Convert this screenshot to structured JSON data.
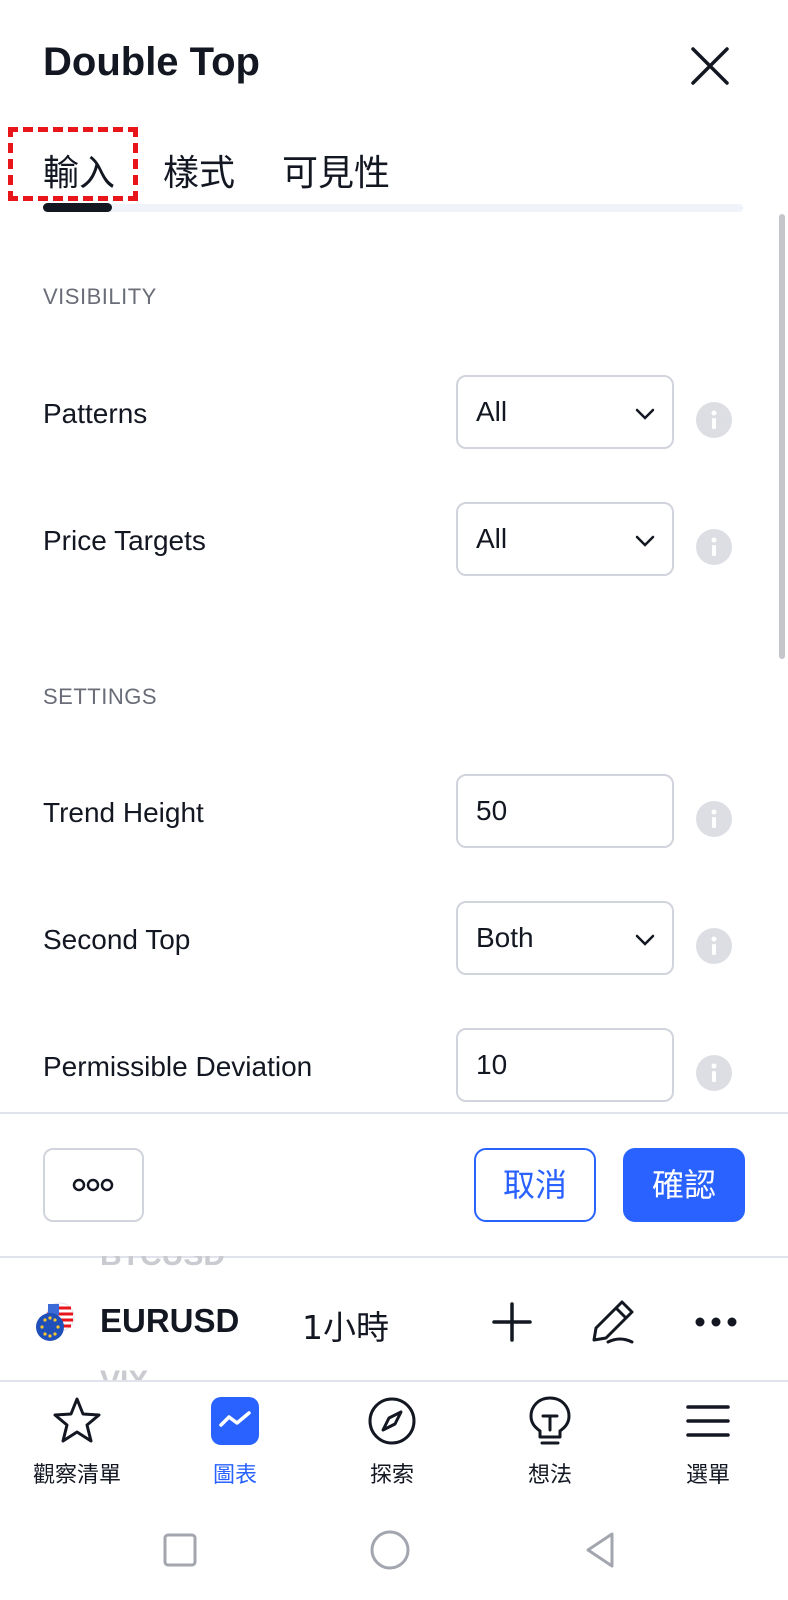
{
  "dialog": {
    "title": "Double Top",
    "tabs": [
      {
        "label": "輸入",
        "active": true
      },
      {
        "label": "樣式",
        "active": false
      },
      {
        "label": "可見性",
        "active": false
      }
    ]
  },
  "sections": {
    "visibility": {
      "header": "VISIBILITY",
      "rows": [
        {
          "label": "Patterns",
          "value": "All"
        },
        {
          "label": "Price Targets",
          "value": "All"
        }
      ]
    },
    "settings": {
      "header": "SETTINGS",
      "rows": [
        {
          "label": "Trend Height",
          "value": "50"
        },
        {
          "label": "Second Top",
          "value": "Both"
        },
        {
          "label": "Permissible Deviation",
          "value": "10"
        }
      ]
    }
  },
  "footer": {
    "more_label": "◦◦◦",
    "cancel_label": "取消",
    "ok_label": "確認"
  },
  "symbol_bar": {
    "ghost_above": "BTCUSD",
    "ghost_below": "VIX",
    "symbol": "EURUSD",
    "interval": "1小時"
  },
  "nav": [
    {
      "label": "觀察清單",
      "icon": "star-icon",
      "active": false
    },
    {
      "label": "圖表",
      "icon": "chart-icon",
      "active": true
    },
    {
      "label": "探索",
      "icon": "compass-icon",
      "active": false
    },
    {
      "label": "想法",
      "icon": "lightbulb-icon",
      "active": false
    },
    {
      "label": "選單",
      "icon": "menu-icon",
      "active": false
    }
  ],
  "colors": {
    "accent": "#2962ff",
    "text": "#131722",
    "muted": "#6a6d78",
    "highlight": "#e8151b"
  }
}
